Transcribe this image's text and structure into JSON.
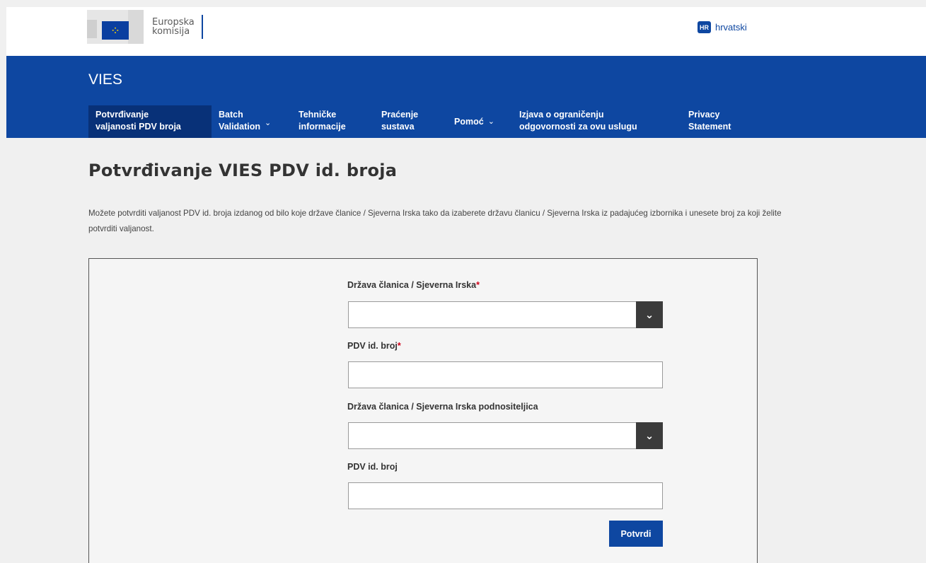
{
  "header": {
    "logo_text_line1": "Europska",
    "logo_text_line2": "komisija",
    "language_code": "HR",
    "language_label": "hrvatski"
  },
  "site": {
    "name": "VIES"
  },
  "nav": {
    "items": [
      {
        "line1": "Potvrđivanje",
        "line2": "valjanosti PDV broja",
        "active": true
      },
      {
        "line1": "Batch",
        "line2": "Validation",
        "dropdown": true
      },
      {
        "line1": "Tehničke",
        "line2": "informacije"
      },
      {
        "line1": "Praćenje",
        "line2": "sustava"
      },
      {
        "line1": "Pomoć",
        "dropdown": true
      },
      {
        "line1": "Izjava o ograničenju",
        "line2": "odgovornosti za ovu uslugu"
      },
      {
        "line1": "Privacy",
        "line2": "Statement"
      }
    ]
  },
  "main": {
    "title": "Potvrđivanje VIES PDV id. broja",
    "intro": "Možete potvrditi valjanost PDV id. broja izdanog od bilo koje države članice / Sjeverna Irska tako da izaberete državu članicu / Sjeverna Irska iz padajućeg izbornika i unesete broj za koji želite potvrditi valjanost."
  },
  "form": {
    "member_state_label": "Država članica / Sjeverna Irska",
    "member_state_value": "",
    "vat_label": "PDV id. broj",
    "vat_value": "",
    "requester_state_label": "Država članica / Sjeverna Irska podnositeljica",
    "requester_state_value": "",
    "requester_vat_label": "PDV id. broj",
    "requester_vat_value": "",
    "required_mark": "*",
    "submit_label": "Potvrdi"
  },
  "colors": {
    "brand_blue": "#0e47a1",
    "active_nav": "#083178",
    "required": "#d0021b"
  }
}
